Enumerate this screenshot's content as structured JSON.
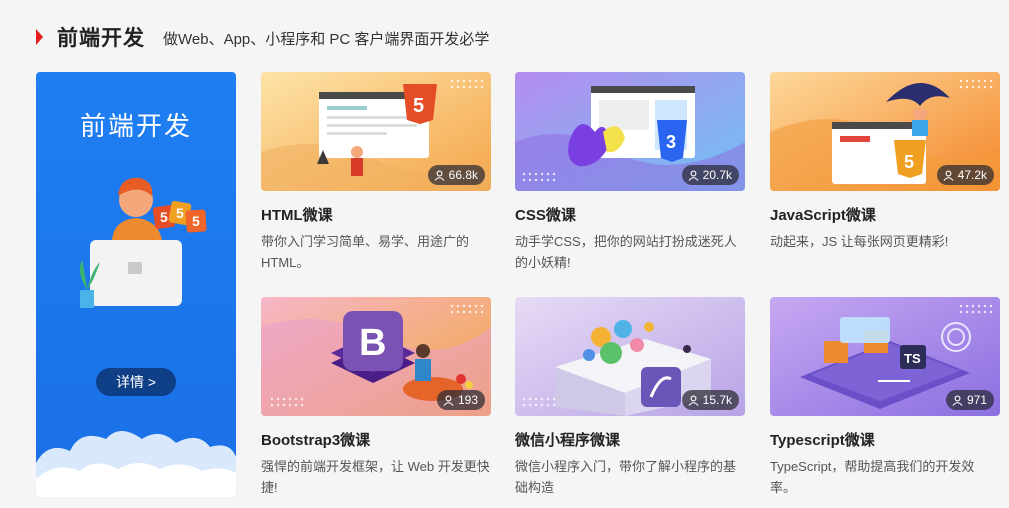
{
  "section": {
    "title": "前端开发",
    "subtitle": "做Web、App、小程序和 PC 客户端界面开发必学"
  },
  "promo": {
    "title": "前端开发",
    "button_label": "详情 >",
    "accent": "#1e7ff2"
  },
  "courses": [
    {
      "title": "HTML微课",
      "desc": "带你入门学习简单、易学、用途广的HTML。",
      "views": "66.8k",
      "icon": "html5-logo"
    },
    {
      "title": "CSS微课",
      "desc": "动手学CSS，把你的网站打扮成迷死人的小妖精!",
      "views": "20.7k",
      "icon": "css3-logo"
    },
    {
      "title": "JavaScript微课",
      "desc": "动起来，JS 让每张网页更精彩!",
      "views": "47.2k",
      "icon": "html5-logo"
    },
    {
      "title": "Bootstrap3微课",
      "desc": "强悍的前端开发框架，让 Web 开发更快捷!",
      "views": "193",
      "icon": "bootstrap-logo"
    },
    {
      "title": "微信小程序微课",
      "desc": "微信小程序入门，带你了解小程序的基础构造",
      "views": "15.7k",
      "icon": "miniprogram-logo"
    },
    {
      "title": "Typescript微课",
      "desc": "TypeScript，帮助提高我们的开发效率。",
      "views": "971",
      "icon": "typescript-logo"
    }
  ]
}
